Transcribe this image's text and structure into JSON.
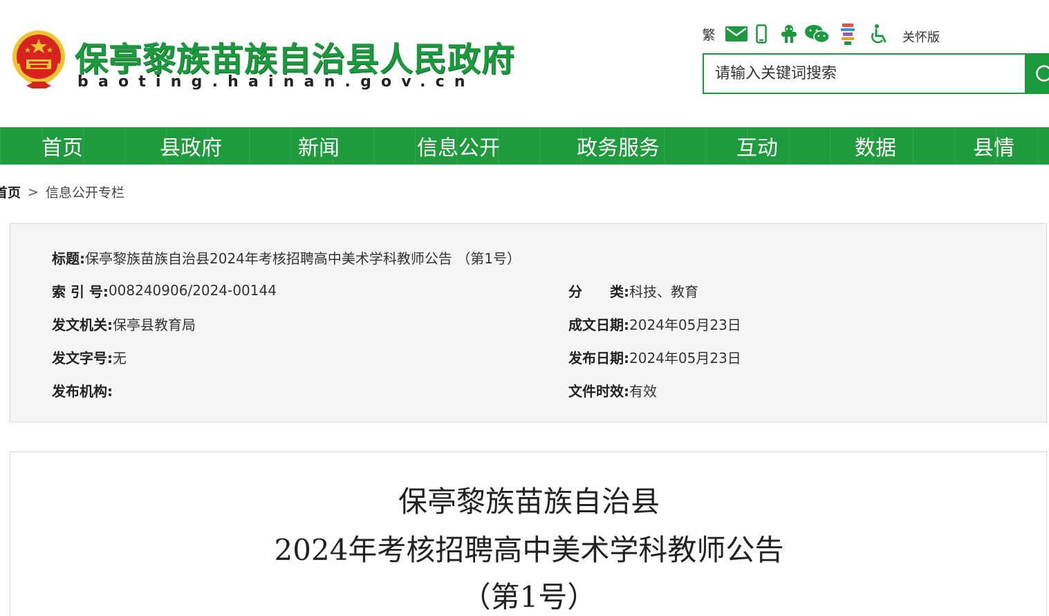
{
  "header": {
    "site_title": "保亭黎族苗族自治县人民政府",
    "site_domain": "baoting.hainan.gov.cn",
    "tools": {
      "traditional_label": "繁",
      "mail_icon": "mail-icon",
      "mobile_icon": "mobile-icon",
      "app_icon": "app-icon",
      "wechat_icon": "wechat-icon",
      "weibo_icon": "weibo-icon",
      "accessibility_icon": "accessibility-icon",
      "elderly_label": "关怀版"
    },
    "search": {
      "placeholder": "请输入关键词搜索"
    },
    "brand_color": "#1a9a3d"
  },
  "nav": {
    "items": [
      {
        "label": "首页"
      },
      {
        "label": "县政府"
      },
      {
        "label": "新闻"
      },
      {
        "label": "信息公开"
      },
      {
        "label": "政务服务"
      },
      {
        "label": "互动"
      },
      {
        "label": "数据"
      },
      {
        "label": "县情"
      }
    ]
  },
  "breadcrumb": {
    "home": "首页",
    "separator": ">",
    "current": "信息公开专栏"
  },
  "info": {
    "title_label": "标题:",
    "title_value": "保亭黎族苗族自治县2024年考核招聘高中美术学科教师公告 （第1号）",
    "index_label": "索 引 号:",
    "index_value": "008240906/2024-00144",
    "category_label": "分　　类:",
    "category_value": "科技、教育",
    "issuer_label": "发文机关:",
    "issuer_value": "保亭县教育局",
    "created_label": "成文日期:",
    "created_value": "2024年05月23日",
    "docno_label": "发文字号:",
    "docno_value": "无",
    "published_label": "发布日期:",
    "published_value": "2024年05月23日",
    "publisher_label": "发布机构:",
    "publisher_value": "",
    "validity_label": "文件时效:",
    "validity_value": "有效"
  },
  "article": {
    "title_line1": "保亭黎族苗族自治县",
    "title_line2": "2024年考核招聘高中美术学科教师公告",
    "title_line3": "（第1号）"
  }
}
